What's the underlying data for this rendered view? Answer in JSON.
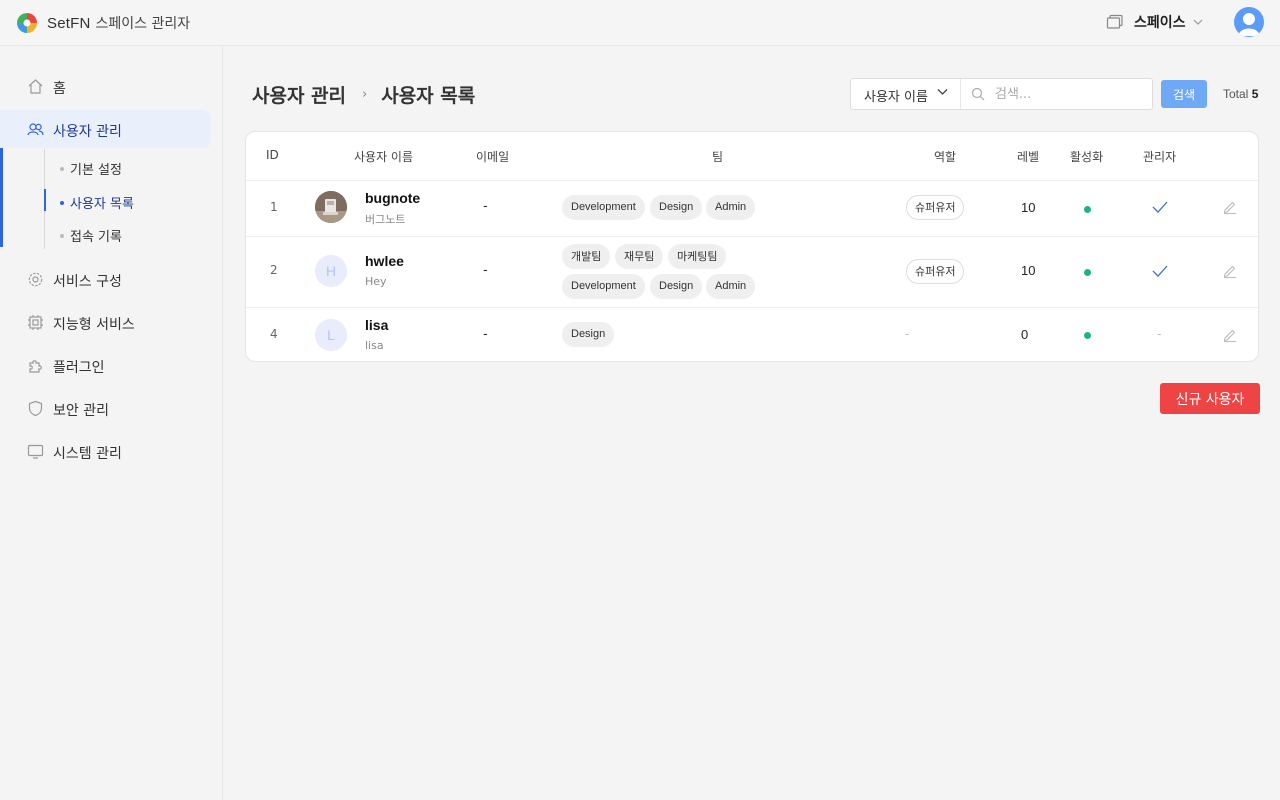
{
  "app": {
    "brand": "SetFN",
    "title": "스페이스 관리자"
  },
  "header": {
    "space_label": "스페이스"
  },
  "sidebar": {
    "items": [
      {
        "label": "홈",
        "icon": "home-icon"
      },
      {
        "label": "사용자 관리",
        "icon": "users-icon",
        "active": true
      },
      {
        "label": "서비스 구성",
        "icon": "gear-icon"
      },
      {
        "label": "지능형 서비스",
        "icon": "chip-icon"
      },
      {
        "label": "플러그인",
        "icon": "puzzle-icon"
      },
      {
        "label": "보안 관리",
        "icon": "shield-icon"
      },
      {
        "label": "시스템 관리",
        "icon": "monitor-icon"
      }
    ],
    "sub_items": [
      {
        "label": "기본 설정"
      },
      {
        "label": "사용자 목록",
        "active": true
      },
      {
        "label": "접속 기록"
      }
    ]
  },
  "breadcrumb": {
    "parent": "사용자 관리",
    "separator": "›",
    "current": "사용자 목록"
  },
  "search": {
    "field": "사용자 이름",
    "placeholder": "검색...",
    "value": "",
    "button": "검색",
    "total_label": "Total",
    "total_count": "5"
  },
  "table": {
    "headers": [
      "ID",
      "사용자 이름",
      "이메일",
      "팀",
      "역할",
      "레벨",
      "활성화",
      "관리자"
    ],
    "rows": [
      {
        "id": "1",
        "name": "bugnote",
        "nickname": "버그노트",
        "email": "-",
        "teams": [
          "Development",
          "Design",
          "Admin"
        ],
        "role": "슈퍼유저",
        "level": "10",
        "active": true,
        "admin": true
      },
      {
        "id": "2",
        "name": "hwlee",
        "nickname": "Hey",
        "initial": "H",
        "email": "-",
        "teams": [
          "개발팀",
          "재무팀",
          "마케팅팀",
          "Development",
          "Design",
          "Admin"
        ],
        "role": "슈퍼유저",
        "level": "10",
        "active": true,
        "admin": true
      },
      {
        "id": "4",
        "name": "lisa",
        "nickname": "lisa",
        "initial": "L",
        "email": "-",
        "teams": [
          "Design"
        ],
        "role": "-",
        "level": "0",
        "active": true,
        "admin": "-"
      }
    ]
  },
  "actions": {
    "new_user": "신규 사용자"
  },
  "colors": {
    "accent": "#2f63e0",
    "search_button": "#6fa8f5",
    "new_user_button": "#ee4444",
    "active_dot": "#1fb57a"
  }
}
